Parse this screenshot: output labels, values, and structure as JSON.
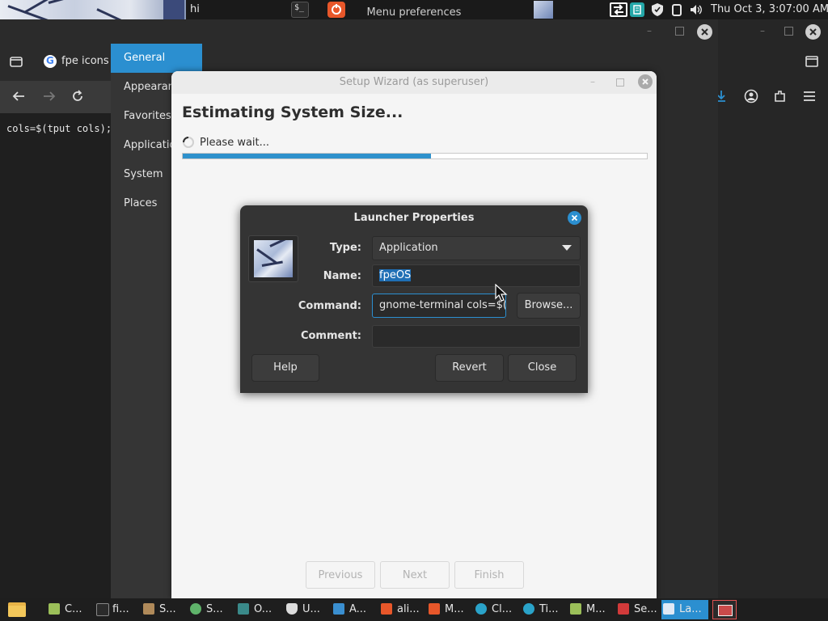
{
  "top_panel": {
    "title": "hi",
    "clock": "Thu Oct  3,  3:07:00 AM"
  },
  "menu_prefs": {
    "title": "Menu preferences",
    "sidebar": [
      "General",
      "Appearance",
      "Favorites",
      "Applications",
      "System",
      "Places"
    ],
    "active_index": 0
  },
  "browser": {
    "tab_label": "fpe icons -"
  },
  "terminal": {
    "text": "cols=$(tput cols);"
  },
  "wizard": {
    "title": "Setup Wizard (as superuser)",
    "heading": "Estimating System Size...",
    "status": "Please wait...",
    "progress": 0.535,
    "buttons": {
      "previous": "Previous",
      "next": "Next",
      "finish": "Finish"
    }
  },
  "launcher": {
    "title": "Launcher Properties",
    "type_label": "Type:",
    "type_value": "Application",
    "name_label": "Name:",
    "name_value": "fpeOS",
    "command_label": "Command:",
    "command_value": "gnome-terminal cols=$(t",
    "comment_label": "Comment:",
    "comment_value": "",
    "browse": "Browse...",
    "help": "Help",
    "revert": "Revert",
    "close": "Close"
  },
  "taskbar": {
    "items": [
      "C...",
      "fi...",
      "S...",
      "S...",
      "O...",
      "U...",
      "A...",
      "ali...",
      "M...",
      "Cl...",
      "Ti...",
      "M...",
      "Se...",
      "La..."
    ]
  },
  "colors": {
    "accent": "#2b8fd0",
    "progress": "#2e91cc",
    "selection": "#1f6fb5"
  }
}
